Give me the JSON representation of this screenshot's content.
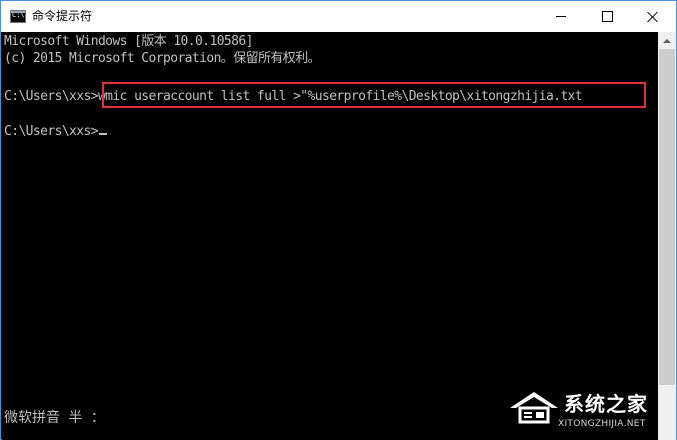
{
  "window": {
    "title": "命令提示符",
    "icon": "cmd-icon",
    "icon_text": "C:\\"
  },
  "console": {
    "lines": [
      "Microsoft Windows [版本 10.0.10586]",
      "(c) 2015 Microsoft Corporation。保留所有权利。",
      "C:\\Users\\xxs>wmic useraccount list full >\"%userprofile%\\Desktop\\xitongzhijia.txt",
      "C:\\Users\\xxs>"
    ],
    "ime_status": "微软拼音 半 ："
  },
  "watermark": {
    "name": "系统之家",
    "url": "XITONGZHIJIA.NET"
  },
  "colors": {
    "console_bg": "#000000",
    "console_text": "#c0c0c0",
    "highlight_border": "#e0303a",
    "window_border": "#4a90d9"
  }
}
